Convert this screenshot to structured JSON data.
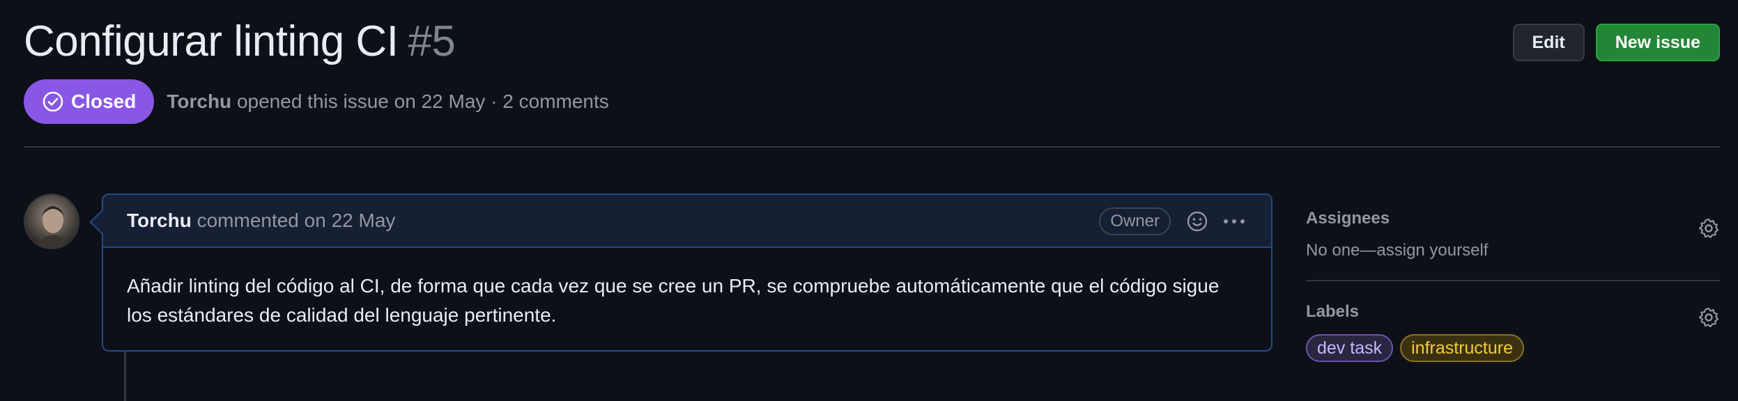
{
  "issue": {
    "title": "Configurar linting CI",
    "number": "#5",
    "state": "Closed",
    "author": "Torchu",
    "meta_suffix": " opened this issue on 22 May · 2 comments"
  },
  "header_actions": {
    "edit_label": "Edit",
    "new_issue_label": "New issue"
  },
  "comment": {
    "author": "Torchu",
    "meta": " commented on 22 May",
    "role_badge": "Owner",
    "body": "Añadir linting del código al CI, de forma que cada vez que se cree un PR, se compruebe automáticamente que el código sigue los estándares de calidad del lenguaje pertinente."
  },
  "sidebar": {
    "assignees": {
      "title": "Assignees",
      "value": "No one—assign yourself"
    },
    "labels": {
      "title": "Labels",
      "items": [
        "dev task",
        "infrastructure"
      ]
    }
  },
  "icons": {
    "state": "check-circle-icon",
    "reaction": "smiley-icon",
    "more": "kebab-horizontal-icon",
    "settings": "gear-icon"
  },
  "colors": {
    "background": "#0d1117",
    "closed_badge": "#8957e5",
    "new_issue_button": "#238636",
    "comment_border": "#1f4b8e",
    "label_dev_task": "#c6b8ff",
    "label_infrastructure": "#f2cc35"
  }
}
